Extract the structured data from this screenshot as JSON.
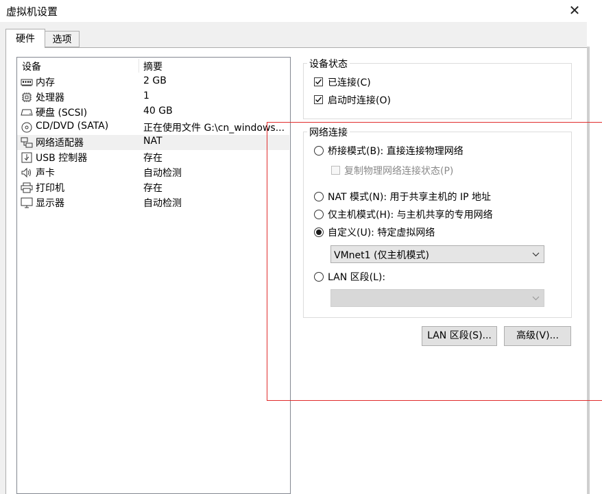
{
  "window": {
    "title": "虚拟机设置"
  },
  "tabs": {
    "hardware": "硬件",
    "options": "选项"
  },
  "device_list": {
    "col_device": "设备",
    "col_summary": "摘要",
    "rows": [
      {
        "name": "内存",
        "summary": "2 GB",
        "icon": "memory-icon"
      },
      {
        "name": "处理器",
        "summary": "1",
        "icon": "processor-icon"
      },
      {
        "name": "硬盘 (SCSI)",
        "summary": "40 GB",
        "icon": "harddisk-icon"
      },
      {
        "name": "CD/DVD (SATA)",
        "summary": "正在使用文件 G:\\cn_windows...",
        "icon": "cd-dvd-icon"
      },
      {
        "name": "网络适配器",
        "summary": "NAT",
        "icon": "network-adapter-icon"
      },
      {
        "name": "USB 控制器",
        "summary": "存在",
        "icon": "usb-icon"
      },
      {
        "name": "声卡",
        "summary": "自动检测",
        "icon": "sound-card-icon"
      },
      {
        "name": "打印机",
        "summary": "存在",
        "icon": "printer-icon"
      },
      {
        "name": "显示器",
        "summary": "自动检测",
        "icon": "display-icon"
      }
    ]
  },
  "device_status": {
    "title": "设备状态",
    "connected": {
      "label": "已连接(C)",
      "checked": true
    },
    "connect_at_power_on": {
      "label": "启动时连接(O)",
      "checked": true
    }
  },
  "network_connection": {
    "title": "网络连接",
    "bridged": {
      "label": "桥接模式(B): 直接连接物理网络",
      "selected": false
    },
    "replicate_state": {
      "label": "复制物理网络连接状态(P)",
      "checked": false,
      "disabled": true
    },
    "nat": {
      "label": "NAT 模式(N): 用于共享主机的 IP 地址",
      "selected": false
    },
    "host_only": {
      "label": "仅主机模式(H): 与主机共享的专用网络",
      "selected": false
    },
    "custom": {
      "label": "自定义(U): 特定虚拟网络",
      "selected": true
    },
    "custom_select_value": "VMnet1 (仅主机模式)",
    "lan_segment": {
      "label": "LAN 区段(L):",
      "selected": false
    },
    "lan_select_value": ""
  },
  "buttons": {
    "lan_segments": "LAN 区段(S)...",
    "advanced": "高级(V)..."
  },
  "colors": {
    "annotation_red": "#e02b2b"
  }
}
